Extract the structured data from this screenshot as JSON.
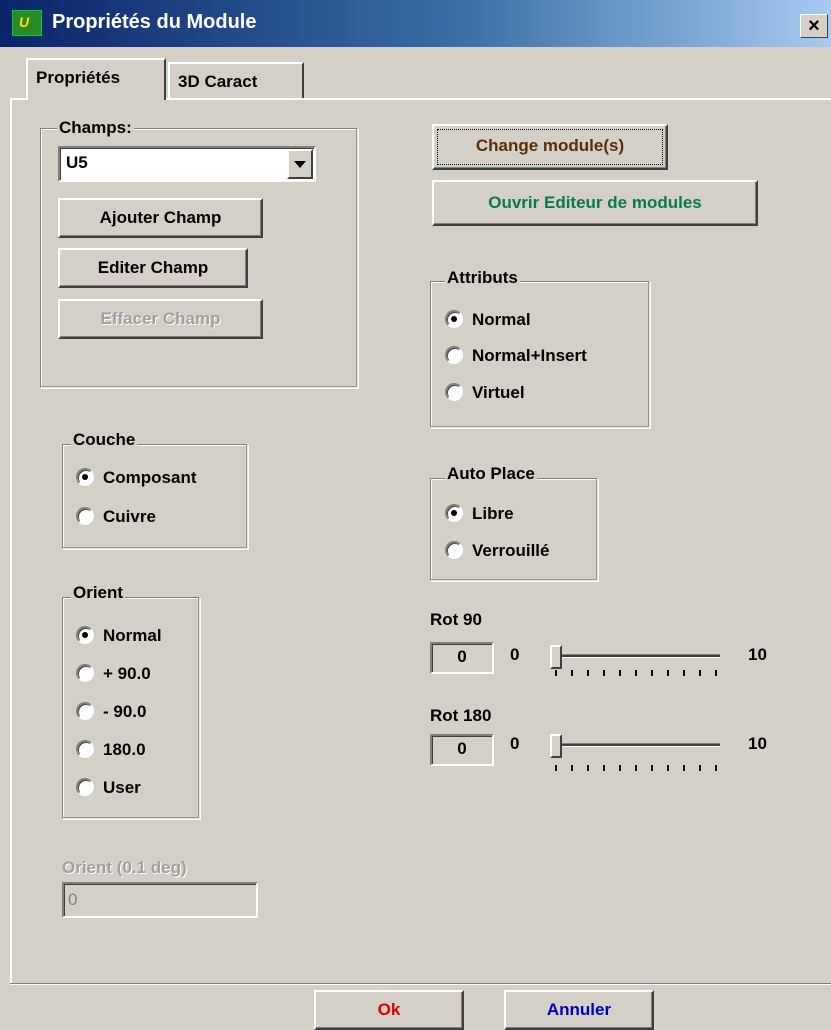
{
  "window": {
    "title": "Propriétés du Module",
    "close_label": "×",
    "icon_label": "U"
  },
  "tabs": [
    {
      "label": "Propriétés",
      "active": true
    },
    {
      "label": "3D Caract",
      "active": false
    }
  ],
  "champs": {
    "legend": "Champs:",
    "selected": "U5",
    "add_label": "Ajouter Champ",
    "edit_label": "Editer Champ",
    "delete_label": "Effacer Champ"
  },
  "couche": {
    "legend": "Couche",
    "options": [
      "Composant",
      "Cuivre"
    ],
    "selected_index": 0
  },
  "orient": {
    "legend": "Orient",
    "options": [
      "Normal",
      "+ 90.0",
      "- 90.0",
      "180.0",
      "User"
    ],
    "selected_index": 0
  },
  "orient_deg": {
    "label": "Orient (0.1 deg)",
    "value": "0"
  },
  "actions": {
    "change_label": "Change module(s)",
    "open_editor_label": "Ouvrir Editeur de modules",
    "change_color": "#5a2e0a",
    "open_editor_color": "#0a7a4a"
  },
  "attributs": {
    "legend": "Attributs",
    "options": [
      "Normal",
      "Normal+Insert",
      "Virtuel"
    ],
    "selected_index": 0
  },
  "autoplace": {
    "legend": "Auto Place",
    "options": [
      "Libre",
      "Verrouillé"
    ],
    "selected_index": 0
  },
  "rot90": {
    "label": "Rot 90",
    "value": "0",
    "min": "0",
    "max": "10",
    "level": 0
  },
  "rot180": {
    "label": "Rot 180",
    "value": "0",
    "min": "0",
    "max": "10",
    "level": 0
  },
  "footer": {
    "ok_label": "Ok",
    "cancel_label": "Annuler",
    "ok_color": "#e00000",
    "cancel_color": "#0000c0"
  }
}
